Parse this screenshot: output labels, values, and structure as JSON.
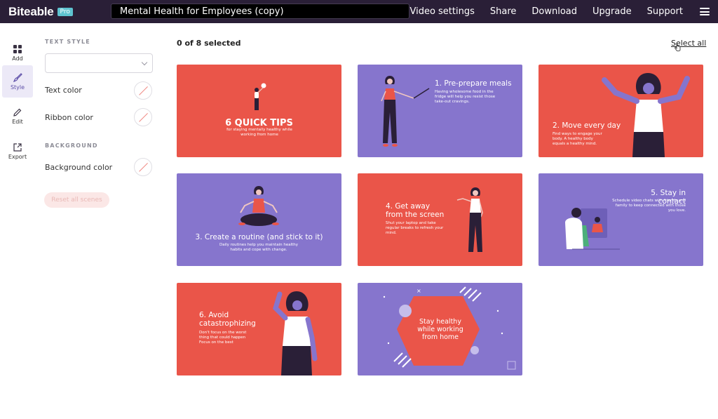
{
  "header": {
    "logo": "Biteable",
    "badge": "Pro",
    "title": "Mental Health for Employees (copy)",
    "nav": [
      "Video settings",
      "Share",
      "Download",
      "Upgrade",
      "Support"
    ]
  },
  "sidebar": {
    "items": [
      {
        "label": "Add",
        "icon": "grid-icon"
      },
      {
        "label": "Style",
        "icon": "brush-icon"
      },
      {
        "label": "Edit",
        "icon": "pencil-icon"
      },
      {
        "label": "Export",
        "icon": "export-icon"
      }
    ]
  },
  "panel": {
    "text_style_title": "TEXT STYLE",
    "text_color": "Text color",
    "ribbon_color": "Ribbon color",
    "background_title": "BACKGROUND",
    "background_color": "Background color",
    "reset": "Reset all scenes"
  },
  "main": {
    "count": "0 of 8 selected",
    "select_all": "Select all"
  },
  "scenes": [
    {
      "title": "6 QUICK TIPS",
      "sub": "for staying mentally healthy while working from home"
    },
    {
      "title": "1. Pre-prepare meals",
      "sub": "Having wholesome food in the fridge will help you resist those take-out cravings."
    },
    {
      "title": "2. Move every day",
      "sub": "Find ways to engage your body. A healthy body equals a healthy mind."
    },
    {
      "title": "3. Create a routine (and stick to it)",
      "sub": "Daily routines help you maintain healthy habits and cope with change."
    },
    {
      "title": "4. Get away from the screen",
      "sub": "Shut your laptop and take regular breaks to refresh your mind."
    },
    {
      "title": "5. Stay in contact",
      "sub": "Schedule video chats with friends and family to keep connected with those you love."
    },
    {
      "title": "6. Avoid catastrophizing",
      "sub": "Don't focus on the worst thing that could happen Focus on the best"
    },
    {
      "title": "Stay healthy while working from home",
      "sub": ""
    }
  ],
  "colors": {
    "red": "#ea5549",
    "purple": "#8675cd",
    "topbar": "#2a1f37"
  }
}
